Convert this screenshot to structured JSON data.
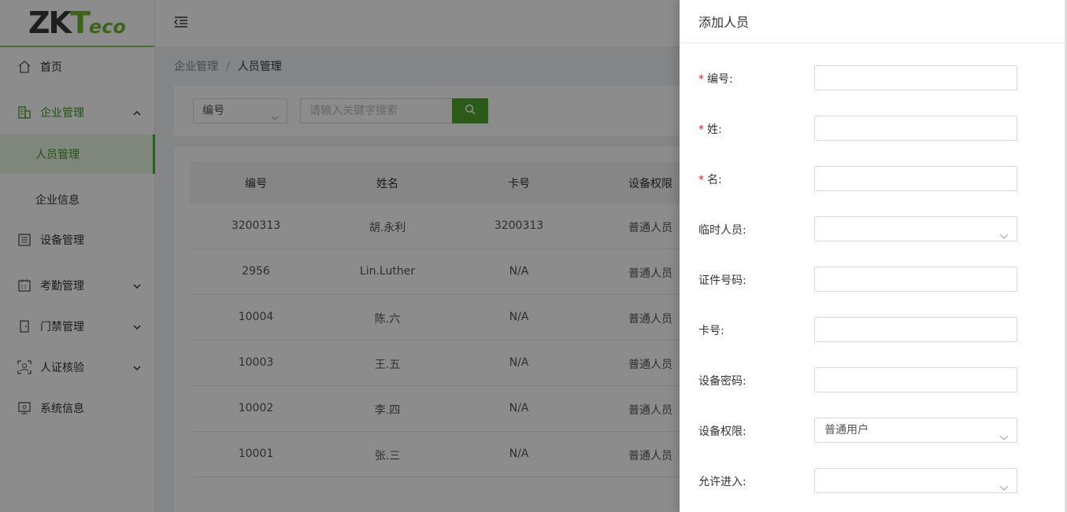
{
  "logo": {
    "part1": "ZK",
    "part2": "T",
    "part3": "eco"
  },
  "sidebar": {
    "items": [
      {
        "label": "首页",
        "icon": "home-icon"
      },
      {
        "label": "企业管理",
        "icon": "building-icon"
      },
      {
        "label": "人员管理"
      },
      {
        "label": "企业信息"
      },
      {
        "label": "设备管理",
        "icon": "device-icon"
      },
      {
        "label": "考勤管理",
        "icon": "attendance-icon"
      },
      {
        "label": "门禁管理",
        "icon": "door-icon"
      },
      {
        "label": "人证核验",
        "icon": "id-verify-icon"
      },
      {
        "label": "系统信息",
        "icon": "system-icon"
      }
    ]
  },
  "breadcrumb": {
    "parent": "企业管理",
    "separator": "/",
    "current": "人员管理"
  },
  "search": {
    "field": "编号",
    "placeholder": "请输入关键字搜索"
  },
  "table": {
    "headers": [
      "编号",
      "姓名",
      "卡号",
      "设备权限"
    ],
    "rows": [
      [
        "3200313",
        "胡.永利",
        "3200313",
        "普通人员"
      ],
      [
        "2956",
        "Lin.Luther",
        "N/A",
        "普通人员"
      ],
      [
        "10004",
        "陈.六",
        "N/A",
        "普通人员"
      ],
      [
        "10003",
        "王.五",
        "N/A",
        "普通人员"
      ],
      [
        "10002",
        "李.四",
        "N/A",
        "普通人员"
      ],
      [
        "10001",
        "张.三",
        "N/A",
        "普通人员"
      ]
    ]
  },
  "drawer": {
    "title": "添加人员",
    "fields": [
      {
        "label": "编号:",
        "required": true,
        "value": "",
        "type": "text"
      },
      {
        "label": "姓:",
        "required": true,
        "value": "",
        "type": "text"
      },
      {
        "label": "名:",
        "required": true,
        "value": "",
        "type": "text"
      },
      {
        "label": "临时人员:",
        "required": false,
        "value": "",
        "type": "select"
      },
      {
        "label": "证件号码:",
        "required": false,
        "value": "",
        "type": "text"
      },
      {
        "label": "卡号:",
        "required": false,
        "value": "",
        "type": "text"
      },
      {
        "label": "设备密码:",
        "required": false,
        "value": "",
        "type": "text"
      },
      {
        "label": "设备权限:",
        "required": false,
        "value": "普通用户",
        "type": "select"
      },
      {
        "label": "允许进入:",
        "required": false,
        "value": "",
        "type": "select"
      }
    ]
  },
  "colors": {
    "accent": "#4ea72e",
    "required": "#f5222d"
  }
}
